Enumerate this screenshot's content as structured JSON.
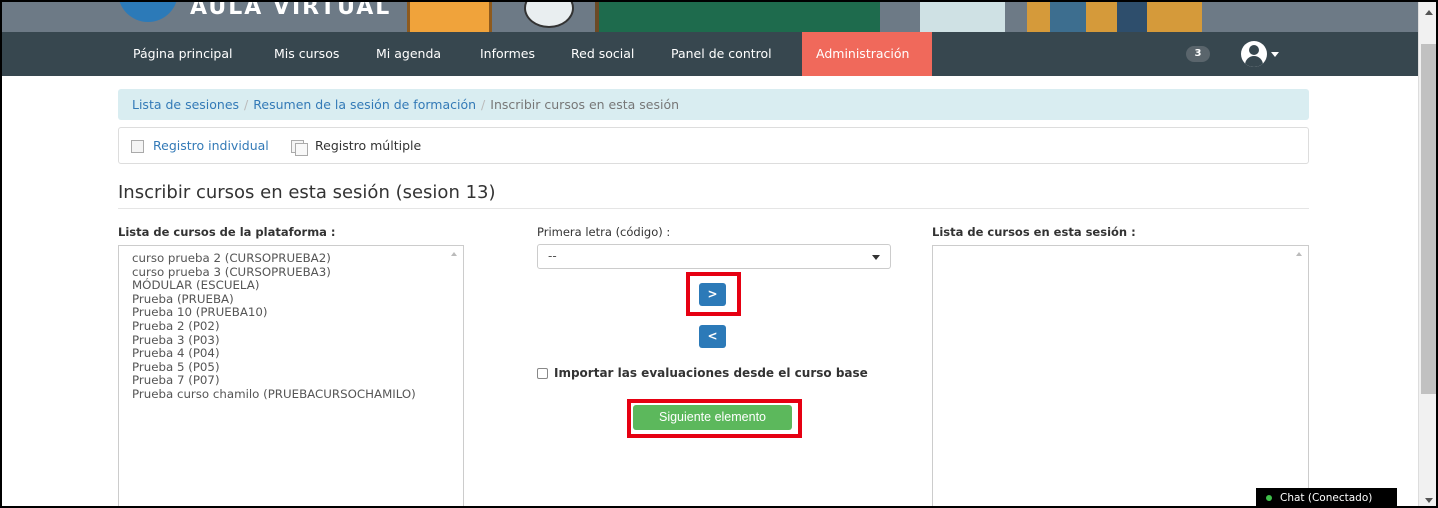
{
  "header": {
    "logo_text": "AULA VIRTUAL"
  },
  "nav": {
    "items": [
      {
        "label": "Página principal"
      },
      {
        "label": "Mis cursos"
      },
      {
        "label": "Mi agenda"
      },
      {
        "label": "Informes"
      },
      {
        "label": "Red social"
      },
      {
        "label": "Panel de control"
      },
      {
        "label": "Administración",
        "active": true
      }
    ],
    "notification_count": "3"
  },
  "breadcrumb": {
    "items": [
      "Lista de sesiones",
      "Resumen de la sesión de formación",
      "Inscribir cursos en esta sesión"
    ],
    "separator": "/"
  },
  "toolbar": {
    "single_label": "Registro individual",
    "multi_label": "Registro múltiple"
  },
  "page": {
    "title": "Inscribir cursos en esta sesión (sesion 13)"
  },
  "left_list": {
    "label": "Lista de cursos de la plataforma :",
    "items": [
      "curso prueba 2 (CURSOPRUEBA2)",
      "curso prueba 3 (CURSOPRUEBA3)",
      "MÓDULAR (ESCUELA)",
      "Prueba (PRUEBA)",
      "Prueba 10 (PRUEBA10)",
      "Prueba 2 (P02)",
      "Prueba 3 (P03)",
      "Prueba 4 (P04)",
      "Prueba 5 (P05)",
      "Prueba 7 (P07)",
      "Prueba curso chamilo (PRUEBACURSOCHAMILO)"
    ]
  },
  "middle": {
    "letter_label": "Primera letra (código) :",
    "letter_value": "--",
    "add_symbol": ">",
    "remove_symbol": "<",
    "import_label": "Importar las evaluaciones desde el curso base",
    "next_label": "Siguiente elemento"
  },
  "right_list": {
    "label": "Lista de cursos en esta sesión :",
    "items": []
  },
  "chat": {
    "status": "Chat (Conectado)"
  },
  "colors": {
    "navbar": "#37474f",
    "active_nav": "#f0695b",
    "primary": "#2c7ab8",
    "success": "#5cb85c",
    "highlight": "#e60012"
  }
}
